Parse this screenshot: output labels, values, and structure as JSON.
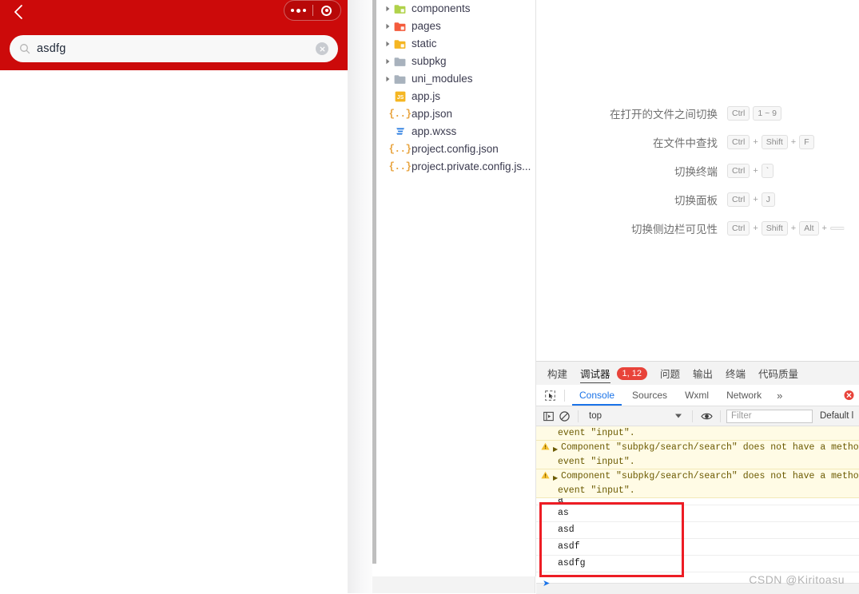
{
  "simulator": {
    "back_icon": "chevron-left-icon",
    "capsule": {
      "menu_icon": "more-dots-icon",
      "target_icon": "target-circle-icon"
    },
    "search": {
      "icon": "search-icon",
      "value": "asdfg",
      "placeholder": "",
      "clear_icon": "clear-circle-icon"
    },
    "header_color": "#cc0a0a"
  },
  "file_tree": {
    "items": [
      {
        "label": "components",
        "type": "folder",
        "icon": "folder-components-icon",
        "expandable": true
      },
      {
        "label": "pages",
        "type": "folder",
        "icon": "folder-pages-icon",
        "expandable": true
      },
      {
        "label": "static",
        "type": "folder",
        "icon": "folder-static-icon",
        "expandable": true
      },
      {
        "label": "subpkg",
        "type": "folder",
        "icon": "folder-icon",
        "expandable": true
      },
      {
        "label": "uni_modules",
        "type": "folder",
        "icon": "folder-icon",
        "expandable": true
      },
      {
        "label": "app.js",
        "type": "file",
        "icon": "js-file-icon",
        "expandable": false
      },
      {
        "label": "app.json",
        "type": "file",
        "icon": "json-file-icon",
        "expandable": false
      },
      {
        "label": "app.wxss",
        "type": "file",
        "icon": "wxss-file-icon",
        "expandable": false
      },
      {
        "label": "project.config.json",
        "type": "file",
        "icon": "json-file-icon",
        "expandable": false
      },
      {
        "label": "project.private.config.js...",
        "type": "file",
        "icon": "json-file-icon",
        "expandable": false
      }
    ]
  },
  "shortcuts": {
    "rows": [
      {
        "label": "在打开的文件之间切换",
        "keys": [
          "Ctrl",
          "1 ~ 9"
        ],
        "separators": [
          ""
        ]
      },
      {
        "label": "在文件中查找",
        "keys": [
          "Ctrl",
          "Shift",
          "F"
        ],
        "separators": [
          "+",
          "+"
        ]
      },
      {
        "label": "切换终端",
        "keys": [
          "Ctrl",
          "`"
        ],
        "separators": [
          "+"
        ]
      },
      {
        "label": "切换面板",
        "keys": [
          "Ctrl",
          "J"
        ],
        "separators": [
          "+"
        ]
      },
      {
        "label": "切换侧边栏可见性",
        "keys": [
          "Ctrl",
          "Shift",
          "Alt",
          ""
        ],
        "separators": [
          "+",
          "+",
          "+"
        ]
      }
    ]
  },
  "devtools": {
    "panel_tabs": [
      {
        "label": "构建",
        "active": false
      },
      {
        "label": "调试器",
        "active": true
      },
      {
        "label": "问题",
        "active": false
      },
      {
        "label": "输出",
        "active": false
      },
      {
        "label": "终端",
        "active": false
      },
      {
        "label": "代码质量",
        "active": false
      }
    ],
    "badge": "1, 12",
    "badge_color": "#e8433a",
    "sub_tabs": [
      {
        "label": "Console",
        "active": true
      },
      {
        "label": "Sources",
        "active": false
      },
      {
        "label": "Wxml",
        "active": false
      },
      {
        "label": "Network",
        "active": false
      }
    ],
    "more_tabs_icon": "chevron-double-right-icon",
    "inspect_icon": "inspect-element-icon",
    "error_icon": "error-close-icon",
    "toolbar": {
      "execute_icon": "execute-sidebar-icon",
      "clear_icon": "clear-console-icon",
      "context": "top",
      "context_caret_icon": "chevron-down-icon",
      "eye_icon": "live-expression-eye-icon",
      "filter_placeholder": "Filter",
      "filter_value": "",
      "level_label": "Default l"
    },
    "console": {
      "messages": [
        {
          "kind": "warning",
          "partial_top": true,
          "line1": "",
          "line2": "event \"input\"."
        },
        {
          "kind": "warning",
          "partial_top": false,
          "icon": "warning-triangle-icon",
          "expand_icon": "expand-arrow-icon",
          "line1": "Component \"subpkg/search/search\" does not have a method",
          "line2": "event \"input\"."
        },
        {
          "kind": "warning",
          "partial_top": false,
          "icon": "warning-triangle-icon",
          "expand_icon": "expand-arrow-icon",
          "line1": "Component \"subpkg/search/search\" does not have a method",
          "line2": "event \"input\"."
        },
        {
          "kind": "log",
          "text": "a",
          "clipped": true
        },
        {
          "kind": "log",
          "text": "as"
        },
        {
          "kind": "log",
          "text": "asd"
        },
        {
          "kind": "log",
          "text": "asdf"
        },
        {
          "kind": "log",
          "text": "asdfg"
        }
      ],
      "highlight_color": "#ed1c24",
      "prompt_icon": "console-prompt-caret"
    }
  },
  "watermark": "CSDN @Kiritoasu"
}
